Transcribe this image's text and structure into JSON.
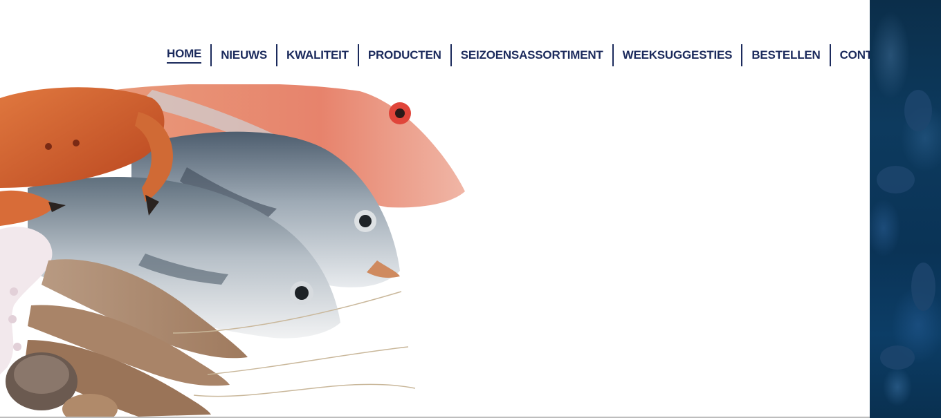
{
  "nav": {
    "items": [
      {
        "label": "HOME",
        "active": true
      },
      {
        "label": "NIEUWS",
        "active": false
      },
      {
        "label": "KWALITEIT",
        "active": false
      },
      {
        "label": "PRODUCTEN",
        "active": false
      },
      {
        "label": "SEIZOENSASSORTIMENT",
        "active": false
      },
      {
        "label": "WEEKSUGGESTIES",
        "active": false
      },
      {
        "label": "BESTELLEN",
        "active": false
      },
      {
        "label": "CONTACT",
        "active": false
      }
    ],
    "text_color": "#1b2a5c"
  },
  "hero": {
    "image": "seafood-assortment-photo",
    "items_depicted": [
      "crab",
      "red gurnard",
      "sea bream",
      "sea bass",
      "prawns",
      "octopus",
      "clams"
    ]
  },
  "colors": {
    "page_background": "#ffffff",
    "side_background": "#0b2e4a"
  }
}
